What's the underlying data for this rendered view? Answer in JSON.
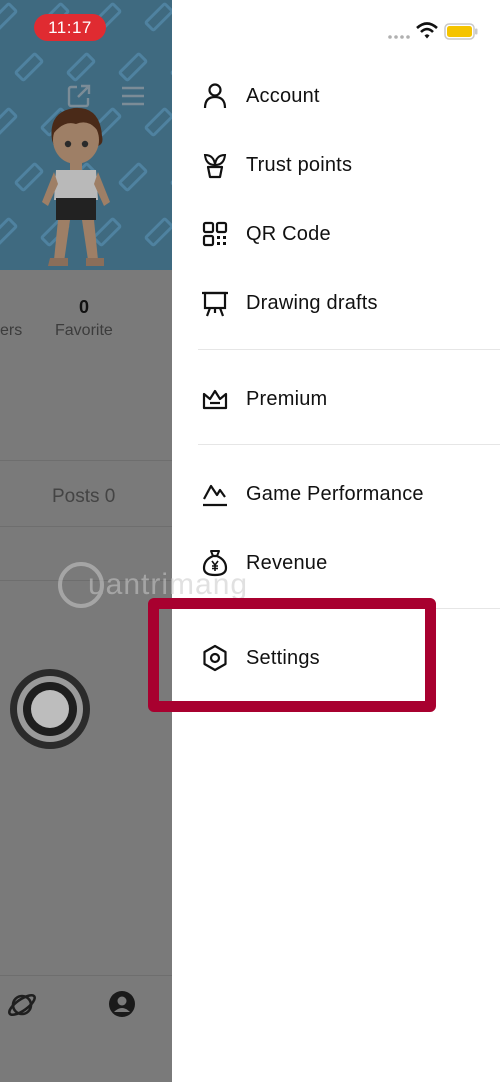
{
  "status_bar": {
    "time": "11:17"
  },
  "background": {
    "stats_left_partial": "ers",
    "favorite_count": "0",
    "favorite_label": "Favorite",
    "posts_label": "Posts 0"
  },
  "menu": {
    "items": [
      {
        "label": "Account",
        "icon": "person-icon"
      },
      {
        "label": "Trust points",
        "icon": "sprout-icon"
      },
      {
        "label": "QR Code",
        "icon": "qr-code-icon"
      },
      {
        "label": "Drawing drafts",
        "icon": "easel-icon"
      },
      {
        "label": "Premium",
        "icon": "crown-icon"
      },
      {
        "label": "Game Performance",
        "icon": "chart-line-icon"
      },
      {
        "label": "Revenue",
        "icon": "money-bag-icon"
      },
      {
        "label": "Settings",
        "icon": "settings-hexagon-icon"
      }
    ]
  },
  "watermark": {
    "text": "uantrimang"
  },
  "colors": {
    "highlight": "#a8002f",
    "time_pill": "#e02b31",
    "battery": "#f5c400"
  }
}
